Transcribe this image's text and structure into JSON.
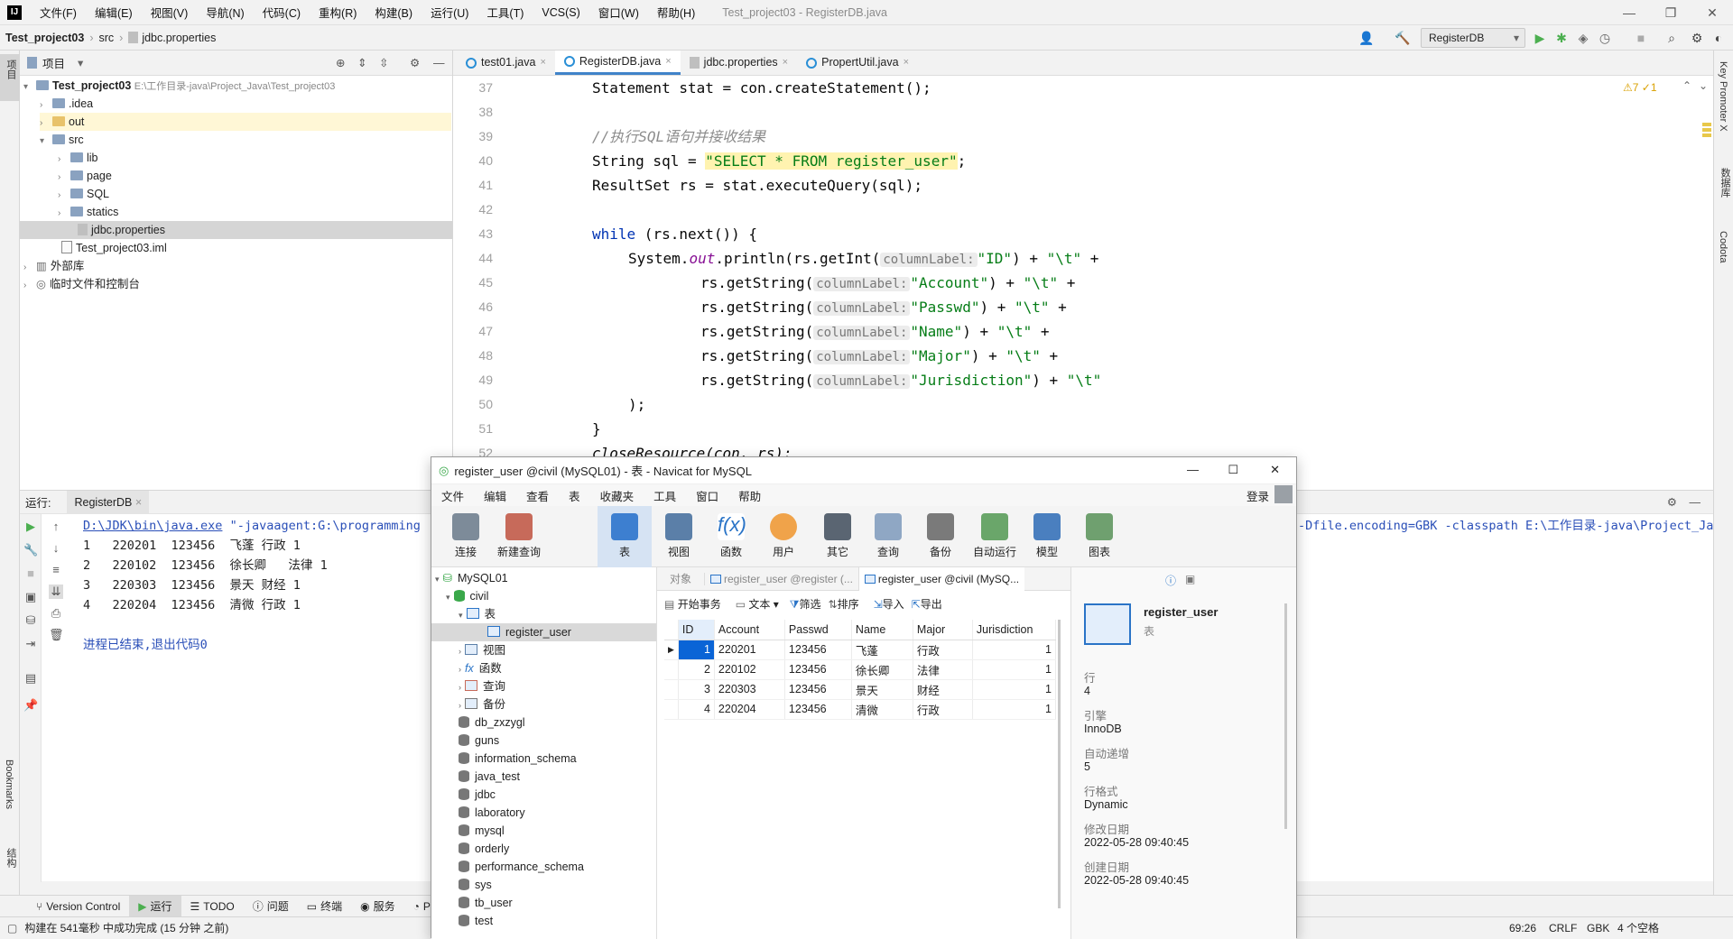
{
  "menubar": {
    "items": [
      "文件(F)",
      "编辑(E)",
      "视图(V)",
      "导航(N)",
      "代码(C)",
      "重构(R)",
      "构建(B)",
      "运行(U)",
      "工具(T)",
      "VCS(S)",
      "窗口(W)",
      "帮助(H)"
    ],
    "title": "Test_project03 - RegisterDB.java"
  },
  "nav": {
    "project": "Test_project03",
    "src": "src",
    "file": "jdbc.properties",
    "run_config": "RegisterDB"
  },
  "proj": {
    "header": "项目",
    "root": "Test_project03",
    "root_path": "E:\\工作目录-java\\Project_Java\\Test_project03",
    "items": [
      ".idea",
      "out",
      "src",
      "lib",
      "page",
      "SQL",
      "statics",
      "jdbc.properties",
      "Test_project03.iml",
      "外部库",
      "临时文件和控制台"
    ]
  },
  "left_stripe": [
    "项目",
    "Bookmarks",
    "结构"
  ],
  "right_stripe": [
    "Key Promoter X",
    "数据库",
    "Codota"
  ],
  "tabs": [
    "test01.java",
    "RegisterDB.java",
    "jdbc.properties",
    "PropertUtil.java"
  ],
  "editor": {
    "inspections": "⚠7 ✓1",
    "lines": [
      "37",
      "38",
      "39",
      "40",
      "41",
      "42",
      "43",
      "44",
      "45",
      "46",
      "47",
      "48",
      "49",
      "50",
      "51",
      "52"
    ],
    "code": {
      "l37": "Statement stat = con.createStatement();",
      "l39": "//执行SQL语句并接收结果",
      "l40a": "String sql = ",
      "l40b": "\"SELECT * FROM register_user\"",
      "l40c": ";",
      "l41": "ResultSet rs = stat.executeQuery(sql);",
      "l43a": "while",
      "l43b": " (rs.next()) {",
      "l44a": "System.",
      "l44b": "out",
      "l44c": ".println(rs.getInt(",
      "l44d": "\"ID\"",
      "l44e": ") + ",
      "l44f": "\"\\t\"",
      "l44g": " +",
      "hint": "columnLabel:",
      "c45": "\"Account\"",
      "c46": "\"Passwd\"",
      "c47": "\"Name\"",
      "c48": "\"Major\"",
      "c49": "\"Jurisdiction\"",
      "tab": "\"\\t\"",
      "getstr": "rs.getString(",
      "close1": ") + ",
      "plus": " +",
      "l50": ");",
      "l51": "}",
      "l52": "closeResource(con, rs);"
    }
  },
  "run": {
    "label": "运行:",
    "tab": "RegisterDB",
    "cmd_link": "D:\\JDK\\bin\\java.exe",
    "cmd_rest": " \"-javaagent:G:\\programming",
    "cmd_tail": "-Dfile.encoding=GBK -classpath E:\\工作目录-java\\Project_Ja",
    "out": [
      "1   220201  123456  飞蓬 行政 1",
      "2   220102  123456  徐长卿   法律 1",
      "3   220303  123456  景天 财经 1",
      "4   220204  123456  清微 行政 1"
    ],
    "exit": "进程已结束,退出代码0"
  },
  "bottom_tools": [
    "Version Control",
    "运行",
    "TODO",
    "问题",
    "终端",
    "服务",
    "Pr"
  ],
  "status": {
    "msg": "构建在 541毫秒 中成功完成 (15 分钟 之前)",
    "pos": "69:26",
    "eol": "CRLF",
    "enc": "GBK",
    "indent": "4 个空格"
  },
  "navicat": {
    "title": "register_user @civil (MySQL01) - 表 - Navicat for MySQL",
    "menu": [
      "文件",
      "编辑",
      "查看",
      "表",
      "收藏夹",
      "工具",
      "窗口",
      "帮助"
    ],
    "login": "登录",
    "tools": [
      "连接",
      "新建查询",
      "表",
      "视图",
      "函数",
      "用户",
      "其它",
      "查询",
      "备份",
      "自动运行",
      "模型",
      "图表"
    ],
    "tree": {
      "conn": "MySQL01",
      "db": "civil",
      "tables": "表",
      "table": "register_user",
      "views": "视图",
      "funcs": "函数",
      "queries": "查询",
      "backups": "备份",
      "others": [
        "db_zxzygl",
        "guns",
        "information_schema",
        "java_test",
        "jdbc",
        "laboratory",
        "mysql",
        "orderly",
        "performance_schema",
        "sys",
        "tb_user",
        "test"
      ]
    },
    "subtabs": [
      "对象",
      "register_user @register (...",
      "register_user @civil (MySQ..."
    ],
    "actions": [
      "开始事务",
      "文本",
      "筛选",
      "排序",
      "导入",
      "导出"
    ],
    "columns": [
      "ID",
      "Account",
      "Passwd",
      "Name",
      "Major",
      "Jurisdiction"
    ],
    "rows": [
      [
        "1",
        "220201",
        "123456",
        "飞蓬",
        "行政",
        "1"
      ],
      [
        "2",
        "220102",
        "123456",
        "徐长卿",
        "法律",
        "1"
      ],
      [
        "3",
        "220303",
        "123456",
        "景天",
        "财经",
        "1"
      ],
      [
        "4",
        "220204",
        "123456",
        "清微",
        "行政",
        "1"
      ]
    ],
    "side": {
      "name": "register_user",
      "type": "表",
      "rows_label": "行",
      "rows": "4",
      "engine_label": "引擎",
      "engine": "InnoDB",
      "auto_label": "自动递增",
      "auto": "5",
      "fmt_label": "行格式",
      "fmt": "Dynamic",
      "mod_label": "修改日期",
      "mod": "2022-05-28 09:40:45",
      "create_label": "创建日期",
      "create": "2022-05-28 09:40:45"
    }
  }
}
